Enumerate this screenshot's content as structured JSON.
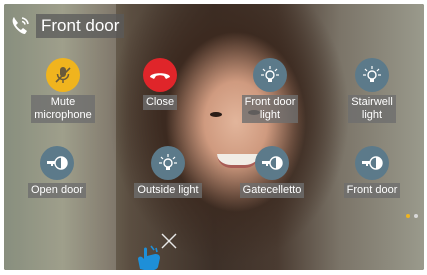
{
  "header": {
    "title": "Front door"
  },
  "buttons": {
    "mute": {
      "label_line1": "Mute",
      "label_line2": "microphone"
    },
    "close": {
      "label": "Close"
    },
    "front_door_light": {
      "label_line1": "Front door",
      "label_line2": "light"
    },
    "stairwell_light": {
      "label_line1": "Stairwell",
      "label_line2": "light"
    },
    "open_door": {
      "label": "Open door"
    },
    "outside_light": {
      "label": "Outside light"
    },
    "gatecelletto": {
      "label": "Gatecelletto"
    },
    "front_door": {
      "label": "Front door"
    }
  },
  "colors": {
    "mute": "#f0b41e",
    "close": "#e0252a",
    "action": "#5c7a8a",
    "dot_active": "#f0b41e",
    "dot_inactive": "#d8d8d8",
    "hand": "#1e8fd8"
  },
  "icons": {
    "call": "phone-call-icon",
    "mute": "microphone-off-icon",
    "close": "hang-up-icon",
    "light": "light-bulb-icon",
    "lock": "key-lock-icon",
    "dismiss": "close-x-icon",
    "gesture": "tap-hand-icon"
  },
  "pagination": {
    "active_index": 0,
    "total": 2
  }
}
